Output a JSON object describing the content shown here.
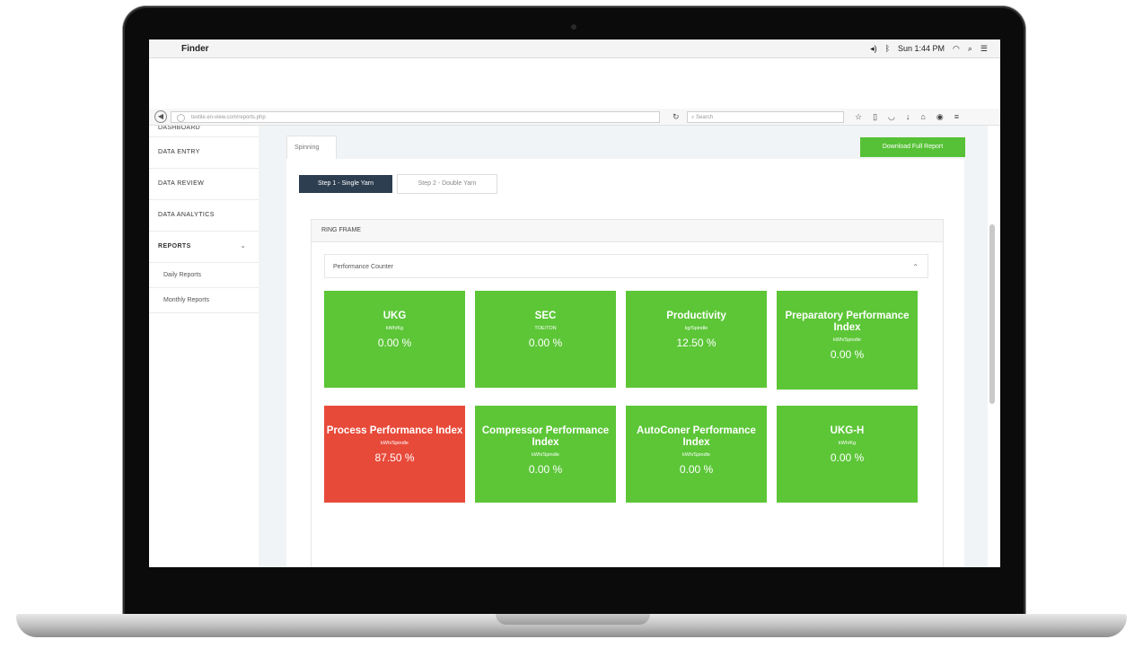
{
  "menubar": {
    "app": "Finder",
    "clock": "Sun 1:44 PM"
  },
  "browser": {
    "url": "textile.en-view.com/reports.php",
    "search_placeholder": "Search"
  },
  "sidebar": {
    "cut_label": "DASHBOARD",
    "items": [
      {
        "label": "DATA ENTRY"
      },
      {
        "label": "DATA REVIEW"
      },
      {
        "label": "DATA ANALYTICS"
      },
      {
        "label": "REPORTS"
      }
    ],
    "subitems": [
      {
        "label": "Daily Reports"
      },
      {
        "label": "Monthly Reports"
      }
    ]
  },
  "content": {
    "tab": "Spinning",
    "download_label": "Download Full Report",
    "step1": "Step 1 - Single Yarn",
    "step2": "Step 2 - Double Yarn",
    "ring_title": "RING FRAME",
    "counter_title": "Performance Counter"
  },
  "cards": [
    {
      "title": "UKG",
      "unit": "kWh/Kg",
      "value": "0.00 %",
      "status": "green"
    },
    {
      "title": "SEC",
      "unit": "TOE/TON",
      "value": "0.00 %",
      "status": "green"
    },
    {
      "title": "Productivity",
      "unit": "kg/Spindle",
      "value": "12.50 %",
      "status": "green"
    },
    {
      "title": "Preparatory Performance Index",
      "unit": "kWh/Spindle",
      "value": "0.00 %",
      "status": "green"
    },
    {
      "title": "Process Performance Index",
      "unit": "kWh/Spindle",
      "value": "87.50 %",
      "status": "red"
    },
    {
      "title": "Compressor Performance Index",
      "unit": "kWh/Spindle",
      "value": "0.00 %",
      "status": "green"
    },
    {
      "title": "AutoConer Performance Index",
      "unit": "kWh/Spindle",
      "value": "0.00 %",
      "status": "green"
    },
    {
      "title": "UKG-H",
      "unit": "kWh/Kg",
      "value": "0.00 %",
      "status": "green"
    }
  ],
  "colors": {
    "green": "#5cc637",
    "red": "#e84a3a",
    "navy": "#2d3e50"
  }
}
